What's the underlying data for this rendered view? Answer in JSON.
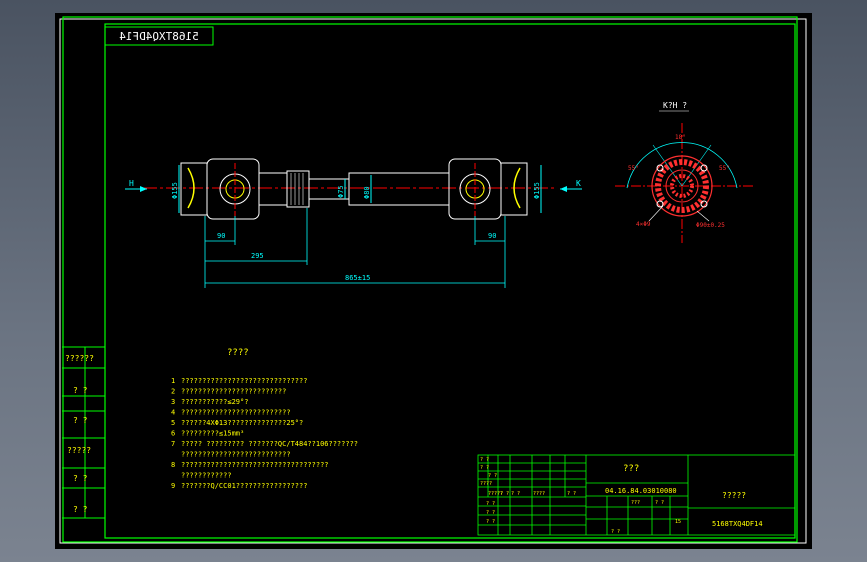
{
  "colors": {
    "background": "#000000",
    "frame": "#00ff00",
    "part": "#ffffff",
    "dimension": "#00ffff",
    "centerline": "#ff0000",
    "hatch": "#ffff00",
    "section": "#ff3030",
    "workspace": "#5b6573"
  },
  "stamp": "5168TXQ4DF14",
  "views": {
    "left_arrow_label": "H",
    "right_arrow_label": "K",
    "section_title": "K?H ?"
  },
  "dimensions": {
    "d1": "Φ155",
    "d2": "Φ75",
    "d3": "Φ80",
    "d4": "Φ155",
    "len_90_left": "90",
    "len_90_right": "90",
    "len_295": "295",
    "len_total": "865±15"
  },
  "section_dims": {
    "angle_top": "18°",
    "angle_left": "55°",
    "angle_right": "55°",
    "bolt_label": "4×Φ9",
    "pcd_label": "Φ90±0.25"
  },
  "side_cells": [
    "??????",
    "? ?",
    "? ?",
    "?????",
    "? ?",
    "? ?"
  ],
  "notes": {
    "title": "????",
    "items": [
      {
        "num": "1",
        "text": "??????????????????????????????"
      },
      {
        "num": "2",
        "text": "?????????????????????????"
      },
      {
        "num": "3",
        "text": "???????????≤29°?"
      },
      {
        "num": "4",
        "text": "??????????????????????????"
      },
      {
        "num": "5",
        "text": "??????4XΦ13??????????????25°?"
      },
      {
        "num": "6",
        "text": "?????????≤15mm³"
      },
      {
        "num": "7",
        "text": "????? ????????? ???????QC/T484??106???????"
      },
      {
        "num": "",
        "text": "??????????????????????????"
      },
      {
        "num": "8",
        "text": "???????????????????????????????????"
      },
      {
        "num": "",
        "text": "????????????"
      },
      {
        "num": "9",
        "text": "???????Q/CC01?????????????????"
      }
    ]
  },
  "title_block": {
    "name": "???",
    "drawing_no": "04.16.84.03010080",
    "company": "?????",
    "part_code": "5168TXQ4DF14",
    "grid_labels": [
      "? ?",
      "? ?",
      "? ?",
      "????",
      "? ?",
      "?????",
      "? ?",
      "????",
      "? ?",
      "? ?",
      "? ?",
      "? ?",
      "15",
      "???",
      "? ?",
      "? ?"
    ]
  }
}
